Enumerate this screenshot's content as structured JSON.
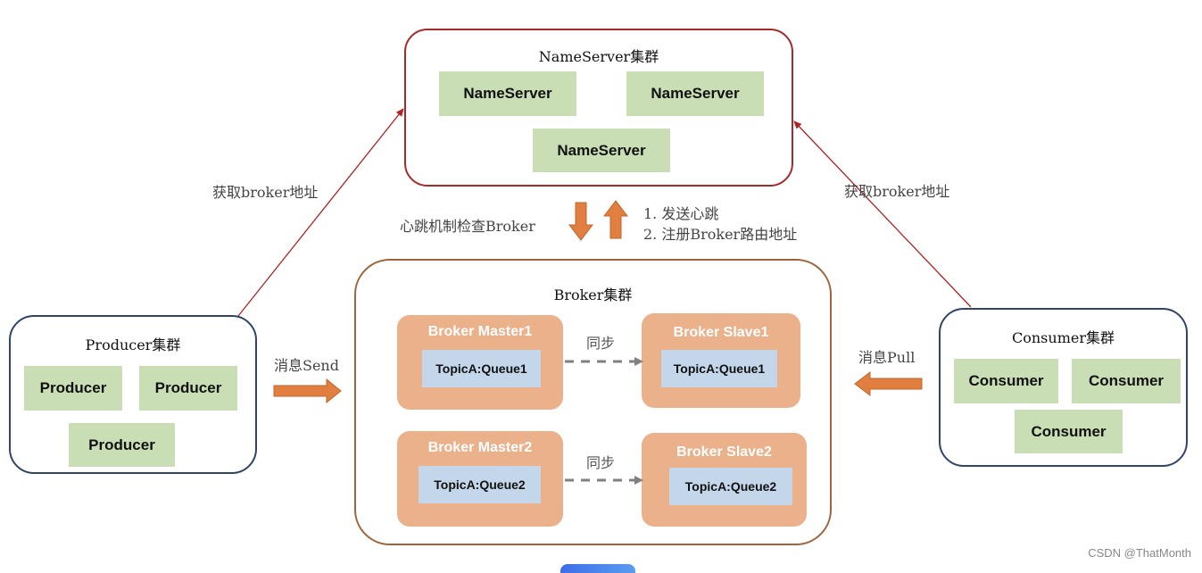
{
  "colors": {
    "nameserver_border": "#a52a2a",
    "broker_border": "#a0643c",
    "client_border": "#2f4468",
    "green_box": "#c9deb5",
    "broker_box": "#eab18a",
    "queue_box": "#c3d6ea",
    "orange_arrow": "#e07f3f",
    "red_line": "#b22222",
    "sync_arrow": "#808080"
  },
  "nameserver_cluster": {
    "title": "NameServer集群",
    "nodes": [
      "NameServer",
      "NameServer",
      "NameServer"
    ]
  },
  "heartbeat": {
    "left_label": "心跳机制检查Broker",
    "right_lines": [
      "1. 发送心跳",
      "2. 注册Broker路由地址"
    ]
  },
  "broker_cluster": {
    "title": "Broker集群",
    "masters": [
      {
        "label": "Broker Master1",
        "queue": "TopicA:Queue1"
      },
      {
        "label": "Broker Master2",
        "queue": "TopicA:Queue2"
      }
    ],
    "slaves": [
      {
        "label": "Broker Slave1",
        "queue": "TopicA:Queue1"
      },
      {
        "label": "Broker Slave2",
        "queue": "TopicA:Queue2"
      }
    ],
    "sync_label": "同步"
  },
  "producer_cluster": {
    "title": "Producer集群",
    "nodes": [
      "Producer",
      "Producer",
      "Producer"
    ],
    "fetch_label": "获取broker地址",
    "send_label": "消息Send"
  },
  "consumer_cluster": {
    "title": "Consumer集群",
    "nodes": [
      "Consumer",
      "Consumer",
      "Consumer"
    ],
    "fetch_label": "获取broker地址",
    "pull_label": "消息Pull"
  },
  "watermark": "CSDN @ThatMonth"
}
